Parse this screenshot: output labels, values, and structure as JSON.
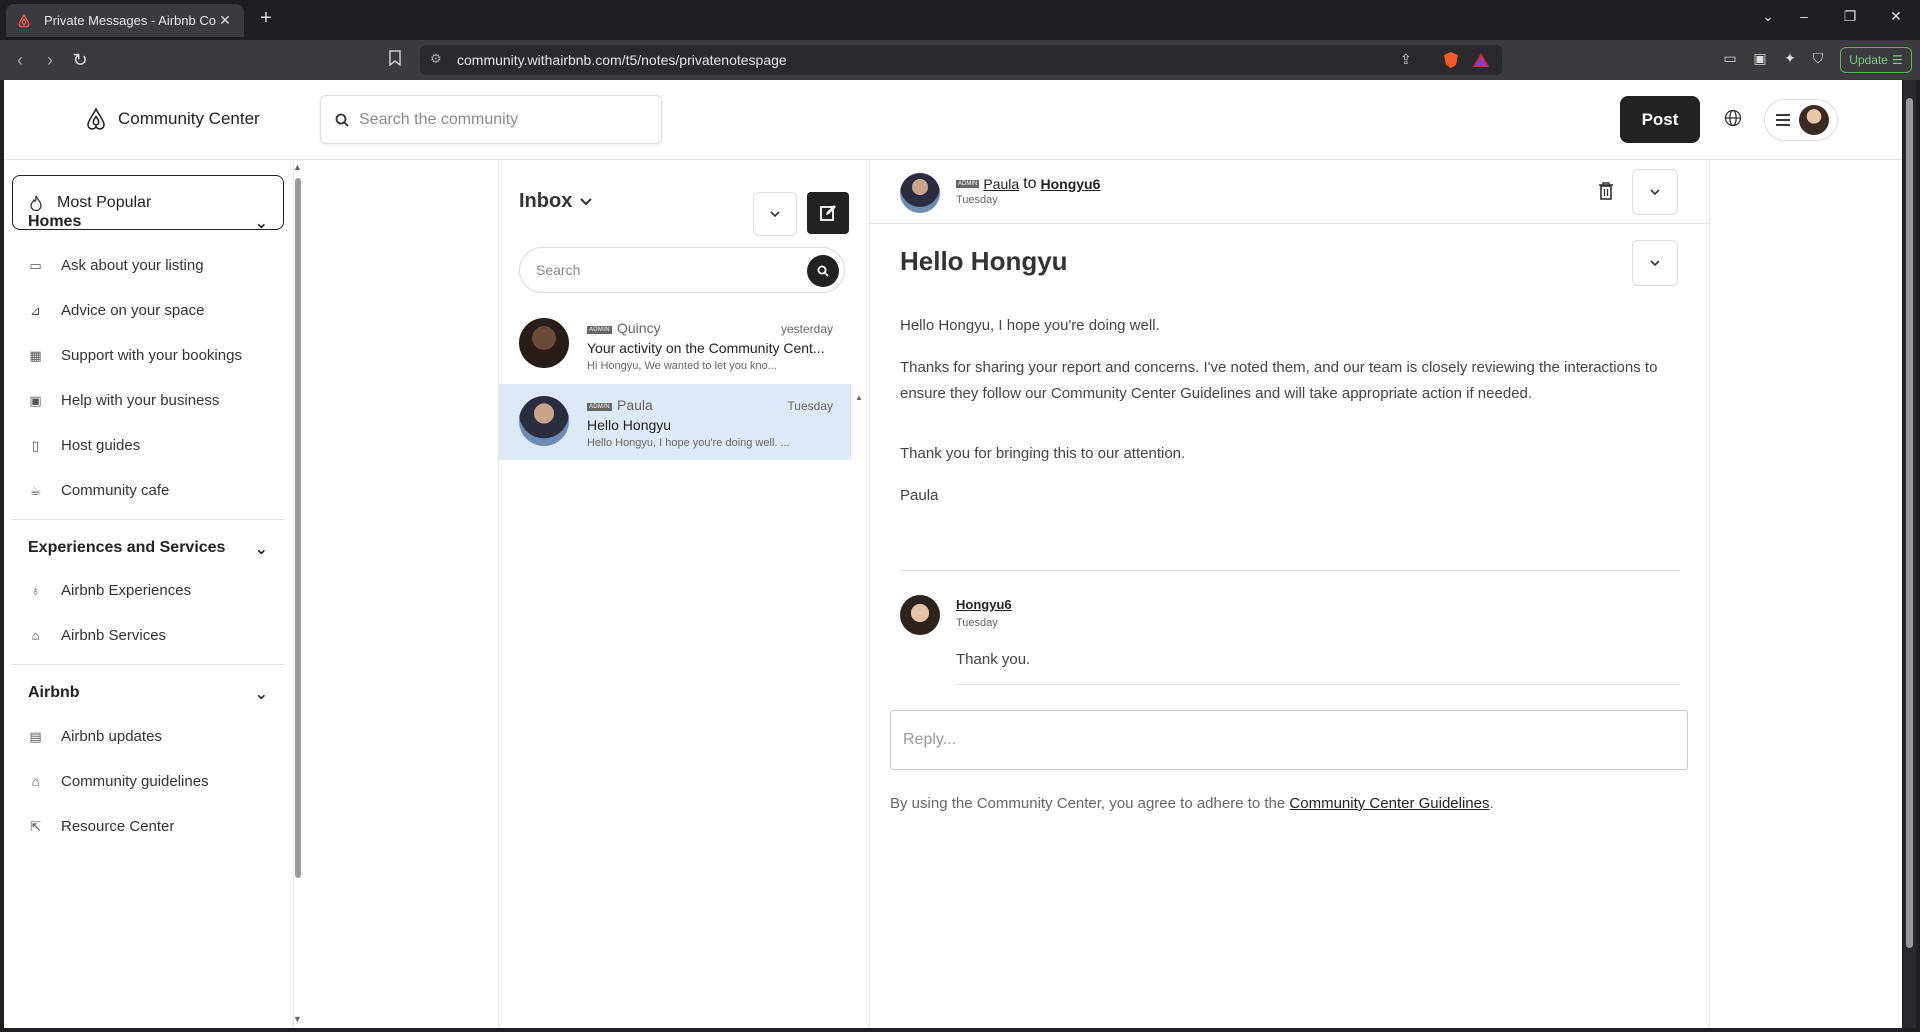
{
  "browser": {
    "tab_title": "Private Messages - Airbnb Comm",
    "url": "community.withairbnb.com/t5/notes/privatenotespage",
    "update_label": "Update"
  },
  "header": {
    "logo_text": "Community Center",
    "search_placeholder": "Search the community",
    "post_label": "Post"
  },
  "sidebar": {
    "most_popular": "Most Popular",
    "sections": [
      {
        "title": "Homes",
        "items": [
          "Ask about your listing",
          "Advice on your space",
          "Support with your bookings",
          "Help with your business",
          "Host guides",
          "Community cafe"
        ]
      },
      {
        "title": "Experiences and Services",
        "items": [
          "Airbnb Experiences",
          "Airbnb Services"
        ]
      },
      {
        "title": "Airbnb",
        "items": [
          "Airbnb updates",
          "Community guidelines",
          "Resource Center"
        ]
      }
    ]
  },
  "inbox": {
    "title": "Inbox",
    "search_placeholder": "Search",
    "messages": [
      {
        "badge": "ADMIN",
        "from": "Quincy",
        "when": "yesterday",
        "subject": "Your activity on the Community Cent...",
        "preview": "Hi Hongyu,   We wanted to let you kno..."
      },
      {
        "badge": "ADMIN",
        "from": "Paula",
        "when": "Tuesday",
        "subject": "Hello Hongyu",
        "preview": "Hello Hongyu, I hope you're doing well. ..."
      }
    ]
  },
  "conversation": {
    "badge": "ADMIN",
    "sender": "Paula",
    "to_word": "to",
    "recipient": "Hongyu6",
    "date": "Tuesday",
    "title": "Hello Hongyu",
    "paragraphs": [
      "Hello Hongyu, I hope you're doing well.",
      "Thanks for sharing your report and concerns. I've noted them, and our team is closely reviewing the interactions to ensure they follow our Community Center Guidelines and will take appropriate action if needed.",
      "Thank you for bringing this to our attention.",
      "Paula"
    ],
    "reply": {
      "author": "Hongyu6",
      "date": "Tuesday",
      "text": "Thank you."
    },
    "reply_placeholder": "Reply...",
    "agree_text": "By using the Community Center, you agree to adhere to the ",
    "agree_link": "Community Center Guidelines",
    "agree_end": "."
  }
}
